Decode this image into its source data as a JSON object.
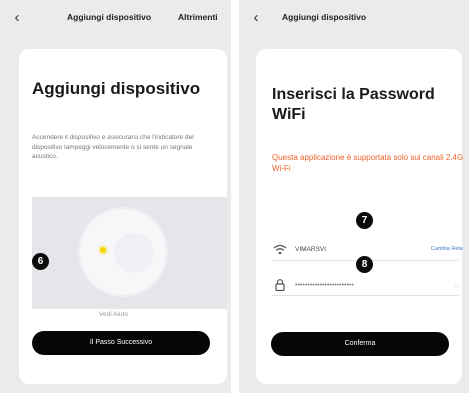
{
  "left_screen": {
    "nav_title": "Aggiungi dispositivo",
    "nav_action": "Altrimenti",
    "back_icon": "chevron-left-icon",
    "title": "Aggiungi dispositivo",
    "description": "Accendere il dispositivo e assicurarsi che l'indicatore del dispositivo lampeggi velocemente o si sente un segnale acustico.",
    "help_link": "Vedi Aiuto",
    "next_button": "Il Passo Successivo",
    "step_badge": "6",
    "led_color": "#f5d400"
  },
  "right_screen": {
    "nav_title": "Aggiungi dispositivo",
    "back_icon": "chevron-left-icon",
    "title": "Inserisci la Password WiFi",
    "warning": "Questa applicazione è supportata solo sui canali 2.4G Wi-Fi",
    "warning_color": "#f0612b",
    "wifi_icon": "wifi-icon",
    "ssid": "VIMARSVI",
    "change_network": "Cambia Rete",
    "lock_icon": "lock-icon",
    "password_value": "••••••••••••••••••••••••",
    "eye_icon": "eye-hidden-icon",
    "confirm_button": "Conferma",
    "step_badge_ssid": "7",
    "step_badge_password": "8"
  }
}
